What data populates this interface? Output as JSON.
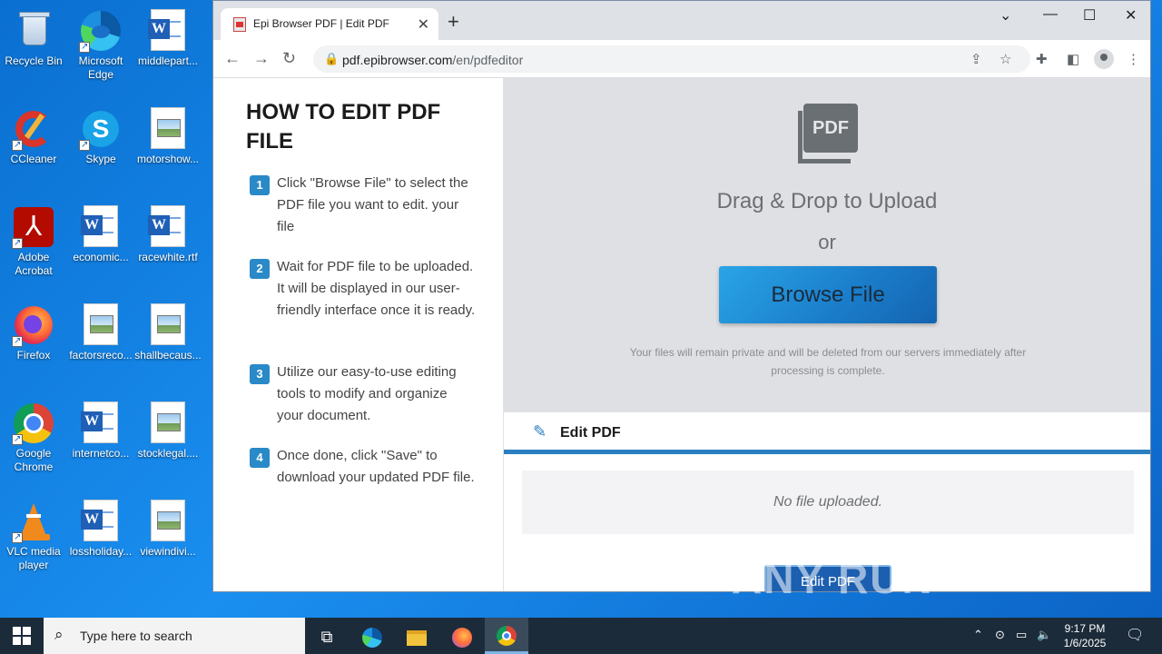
{
  "desktop": {
    "icons": [
      {
        "label": "Recycle Bin"
      },
      {
        "label": "Microsoft Edge"
      },
      {
        "label": "middlepart..."
      },
      {
        "label": "CCleaner"
      },
      {
        "label": "Skype"
      },
      {
        "label": "motorshow..."
      },
      {
        "label": "Adobe Acrobat"
      },
      {
        "label": "economic..."
      },
      {
        "label": "racewhite.rtf"
      },
      {
        "label": "Firefox"
      },
      {
        "label": "factorsreco..."
      },
      {
        "label": "shallbecaus..."
      },
      {
        "label": "Google Chrome"
      },
      {
        "label": "internetco..."
      },
      {
        "label": "stocklegal...."
      },
      {
        "label": "VLC media player"
      },
      {
        "label": "lossholiday..."
      },
      {
        "label": "viewindivi..."
      }
    ]
  },
  "browser": {
    "tab_title": "Epi Browser PDF | Edit PDF",
    "url_host": "pdf.epibrowser.com",
    "url_path": "/en/pdfeditor"
  },
  "page": {
    "heading": "HOW TO EDIT PDF FILE",
    "steps": [
      {
        "num": "1",
        "text": "Click \"Browse File\" to select the PDF file you want to edit. your file"
      },
      {
        "num": "2",
        "text": "Wait for PDF file to be uploaded. It will be displayed in our user-friendly interface once it is ready."
      },
      {
        "num": "3",
        "text": "Utilize our easy-to-use editing tools to modify and organize your document."
      },
      {
        "num": "4",
        "text": "Once done, click \"Save\" to download your updated PDF file."
      }
    ],
    "pdf_icon_text": "PDF",
    "drag_text": "Drag & Drop to Upload",
    "or_text": "or",
    "browse_label": "Browse File",
    "privacy_text": "Your files will remain private and will be deleted from our servers immediately after processing is complete.",
    "edit_section_label": "Edit PDF",
    "no_file_text": "No file uploaded.",
    "edit_button_label": "Edit PDF"
  },
  "watermark": "ANY RUN",
  "taskbar": {
    "search_placeholder": "Type here to search",
    "time": "9:17 PM",
    "date": "1/6/2025"
  }
}
